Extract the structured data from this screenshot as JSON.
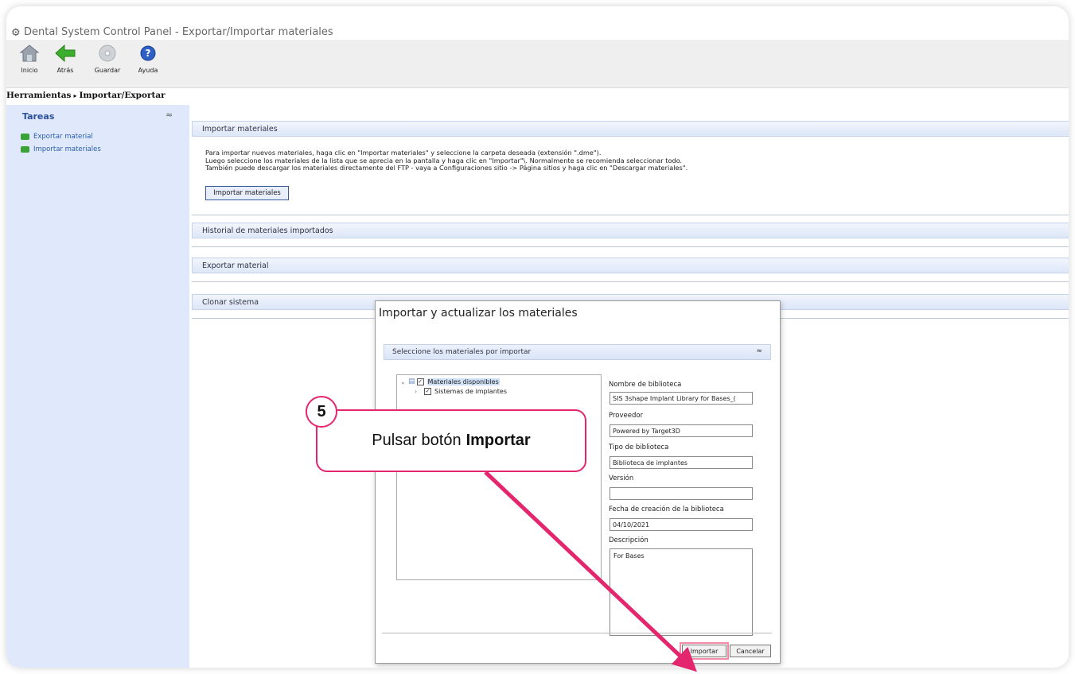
{
  "window": {
    "title": "Dental System Control Panel - Exportar/Importar materiales"
  },
  "toolbar": {
    "buttons": [
      {
        "label": "Inicio",
        "icon": "home-icon"
      },
      {
        "label": "Atrás",
        "icon": "back-arrow-icon"
      },
      {
        "label": "Guardar",
        "icon": "save-disc-icon"
      },
      {
        "label": "Ayuda",
        "icon": "help-icon"
      }
    ]
  },
  "breadcrumb": {
    "root": "Herramientas",
    "current": "Importar/Exportar"
  },
  "sidebar": {
    "title": "Tareas",
    "items": [
      {
        "label": "Exportar material"
      },
      {
        "label": "Importar materiales"
      }
    ]
  },
  "main": {
    "import_section": "Importar materiales",
    "instructions": [
      "Para importar nuevos materiales, haga clic en \"Importar materiales\" y seleccione la carpeta deseada (extensión \".dme\").",
      "Luego seleccione los materiales de la lista que se aprecia en la pantalla y haga clic en \"Importar\"\\. Normalmente se recomienda seleccionar todo.",
      "También puede descargar los materiales directamente del FTP - vaya a Configuraciones sitio -> Página sitios y haga clic en \"Descargar materiales\"."
    ],
    "import_button": "Importar materiales",
    "history_section": "Historial de materiales importados",
    "export_section": "Exportar material",
    "clone_section": "Clonar sistema"
  },
  "dialog": {
    "title": "Importar y actualizar los materiales",
    "section": "Seleccione los materiales por importar",
    "tree": {
      "root": "Materiales disponibles",
      "child": "Sistemas de implantes"
    },
    "fields": {
      "library_name_label": "Nombre de biblioteca",
      "library_name_value": "SIS 3shape Implant Library for Bases_(",
      "provider_label": "Proveedor",
      "provider_value": "Powered by Target3D",
      "library_type_label": "Tipo de biblioteca",
      "library_type_value": "Biblioteca de implantes",
      "version_label": "Versión",
      "version_value": "",
      "creation_date_label": "Fecha de creación de la biblioteca",
      "creation_date_value": "04/10/2021",
      "description_label": "Descripción",
      "description_value": "For Bases"
    },
    "import_button": "Importar",
    "cancel_button": "Cancelar"
  },
  "callout": {
    "step": "5",
    "text": "Pulsar botón",
    "bold": "Importar",
    "color": "#e3266e"
  }
}
